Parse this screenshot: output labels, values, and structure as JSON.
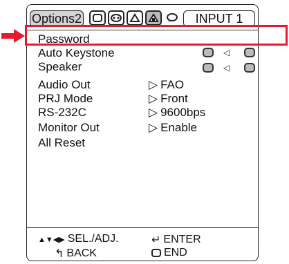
{
  "header": {
    "active_tab": "Options2",
    "input_label": "INPUT 1",
    "tab_icons": [
      "picture-icon",
      "sound-icon",
      "setup-icon",
      "options-icon",
      "language-icon"
    ]
  },
  "menu": {
    "items": [
      {
        "label": "Password",
        "value": ""
      },
      {
        "label": "Auto Keystone",
        "value": ""
      },
      {
        "label": "Speaker",
        "value": ""
      },
      {
        "label": "Audio Out",
        "value": "FAO"
      },
      {
        "label": "PRJ Mode",
        "value": "Front"
      },
      {
        "label": "RS-232C",
        "value": "9600bps"
      },
      {
        "label": "Monitor Out",
        "value": "Enable"
      },
      {
        "label": "All Reset",
        "value": ""
      }
    ]
  },
  "footer": {
    "sel_adj": "SEL./ADJ.",
    "enter": "ENTER",
    "back": "BACK",
    "end": "END"
  },
  "colors": {
    "highlight": "#e8192c"
  }
}
